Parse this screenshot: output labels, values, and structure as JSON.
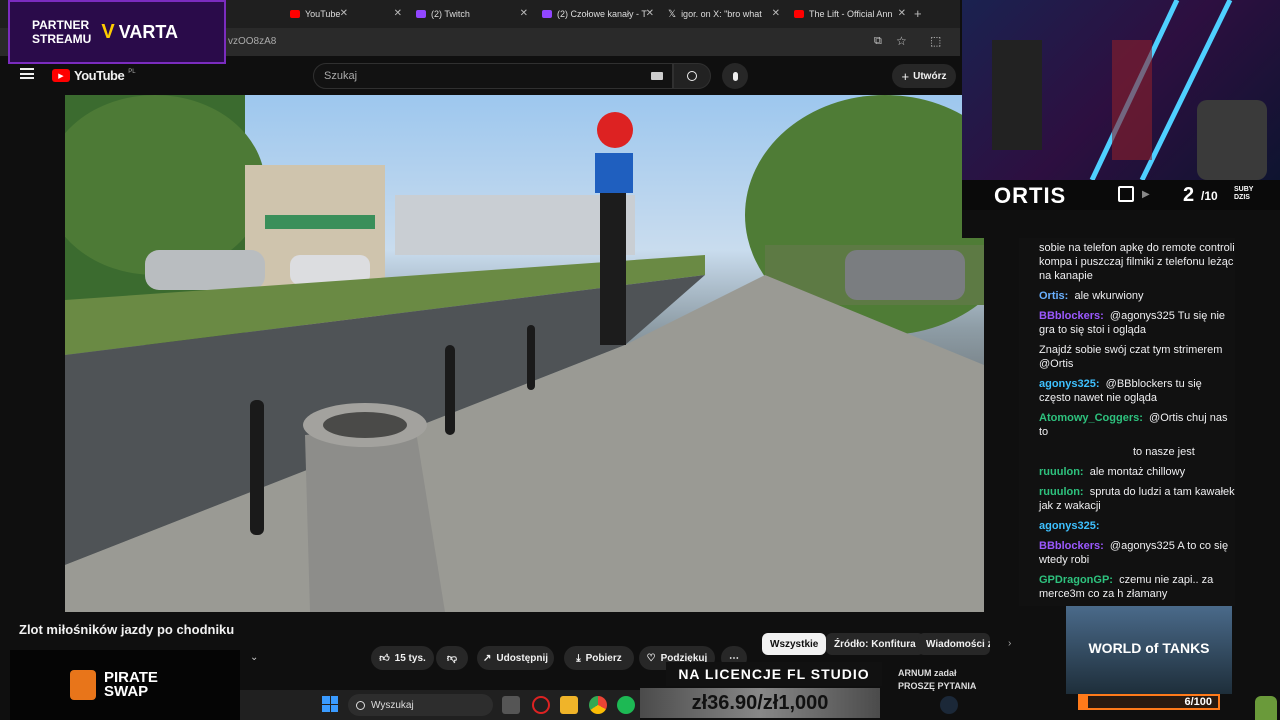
{
  "partner": {
    "line1": "PARTNER",
    "line2": "STREAMU",
    "brand": "VARTA"
  },
  "tabs": [
    {
      "label": "",
      "icon": "x-icon"
    },
    {
      "label": "YouTube",
      "icon": "youtube-icon"
    },
    {
      "label": "(2) Twitch",
      "icon": "twitch-icon"
    },
    {
      "label": "(2) Czołowe kanały - T",
      "icon": "twitch-icon"
    },
    {
      "label": "igor. on X: \"bro what",
      "icon": "x-logo-icon"
    },
    {
      "label": "The Lift - Official Ann",
      "icon": "youtube-icon"
    }
  ],
  "url": "vzOO8zA8",
  "youtube": {
    "logo": "YouTube",
    "region": "PL",
    "search_placeholder": "Szukaj",
    "create_label": "Utwórz"
  },
  "video": {
    "title": "Zlot miłośników jazdy po chodniku"
  },
  "actions": {
    "likes": "15 tys.",
    "share": "Udostępnij",
    "download": "Pobierz",
    "thanks": "Podziękuj"
  },
  "chips": [
    "Wszystkie",
    "Źródło: Konfitura",
    "Wiadomości ze"
  ],
  "overlay": {
    "streamer": "ORTIS",
    "subs_count": "2",
    "subs_goal": "/10",
    "subs_label_1": "SUBY",
    "subs_label_2": "DZIS",
    "fl_studio": "NA LICENCJE FL STUDIO",
    "price": "zł36.90/zł1,000",
    "pirate_1": "PIRATE",
    "pirate_2": "SWAP",
    "tanks_progress": "6/100",
    "side_text_1": "ARNUM zadał",
    "side_text_2": "PROSZĘ PYTANIA"
  },
  "chat": [
    {
      "user": "",
      "color": "#efeff1",
      "text": "sobie na telefon apkę do remote controli kompa i puszczaj filmiki z telefonu leżąc na kanapie"
    },
    {
      "user": "Ortis:",
      "color": "#6ab0ff",
      "text": "ale wkurwiony"
    },
    {
      "user": "BBblockers:",
      "color": "#9b59ff",
      "text": "@agonys325 Tu się nie gra to się stoi i ogląda"
    },
    {
      "user": "",
      "color": "#efeff1",
      "text": "Znajdź sobie swój czat tym strimerem @Ortis"
    },
    {
      "user": "agonys325:",
      "color": "#3ec1ff",
      "text": "@BBblockers tu się często nawet nie ogląda"
    },
    {
      "user": "Atomowy_Coggers:",
      "color": "#2ec27e",
      "text": "@Ortis chuj nas to"
    },
    {
      "user": "",
      "color": "#efeff1",
      "text": "to nasze jest"
    },
    {
      "user": "ruuulon:",
      "color": "#2ec27e",
      "text": "ale montaż chillowy"
    },
    {
      "user": "ruuulon:",
      "color": "#2ec27e",
      "text": "spruta do ludzi a tam kawałek jak z wakacji"
    },
    {
      "user": "agonys325:",
      "color": "#3ec1ff",
      "text": ""
    },
    {
      "user": "BBblockers:",
      "color": "#9b59ff",
      "text": "@agonys325 A to co się wtedy robi"
    },
    {
      "user": "GPDragonGP:",
      "color": "#2ec27e",
      "text": "czemu nie zapi.. za merce3m co za h złamany"
    }
  ],
  "taskbar": {
    "search": "Wyszukaj"
  }
}
